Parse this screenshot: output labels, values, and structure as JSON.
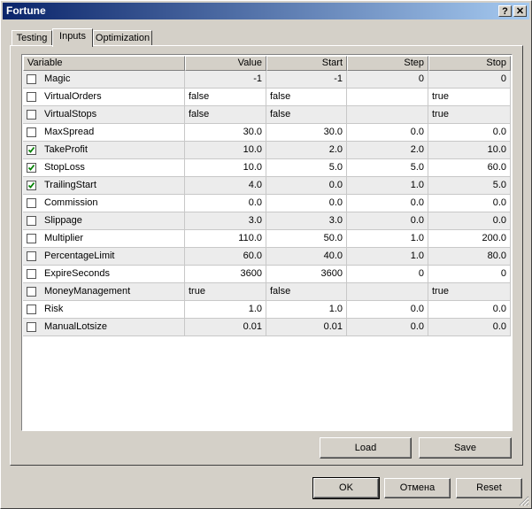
{
  "window": {
    "title": "Fortune",
    "help_glyph": "?",
    "close_glyph": "✕"
  },
  "tabs": [
    {
      "label": "Testing",
      "active": false
    },
    {
      "label": "Inputs",
      "active": true
    },
    {
      "label": "Optimization",
      "active": false
    }
  ],
  "table": {
    "headers": [
      "Variable",
      "Value",
      "Start",
      "Step",
      "Stop"
    ],
    "rows": [
      {
        "checked": false,
        "name": "Magic",
        "value": "-1",
        "start": "-1",
        "step": "0",
        "stop": "0"
      },
      {
        "checked": false,
        "name": "VirtualOrders",
        "value": "false",
        "start": "false",
        "step": "",
        "stop": "true"
      },
      {
        "checked": false,
        "name": "VirtualStops",
        "value": "false",
        "start": "false",
        "step": "",
        "stop": "true"
      },
      {
        "checked": false,
        "name": "MaxSpread",
        "value": "30.0",
        "start": "30.0",
        "step": "0.0",
        "stop": "0.0"
      },
      {
        "checked": true,
        "name": "TakeProfit",
        "value": "10.0",
        "start": "2.0",
        "step": "2.0",
        "stop": "10.0"
      },
      {
        "checked": true,
        "name": "StopLoss",
        "value": "10.0",
        "start": "5.0",
        "step": "5.0",
        "stop": "60.0"
      },
      {
        "checked": true,
        "name": "TrailingStart",
        "value": "4.0",
        "start": "0.0",
        "step": "1.0",
        "stop": "5.0"
      },
      {
        "checked": false,
        "name": "Commission",
        "value": "0.0",
        "start": "0.0",
        "step": "0.0",
        "stop": "0.0"
      },
      {
        "checked": false,
        "name": "Slippage",
        "value": "3.0",
        "start": "3.0",
        "step": "0.0",
        "stop": "0.0"
      },
      {
        "checked": false,
        "name": "Multiplier",
        "value": "110.0",
        "start": "50.0",
        "step": "1.0",
        "stop": "200.0"
      },
      {
        "checked": false,
        "name": "PercentageLimit",
        "value": "60.0",
        "start": "40.0",
        "step": "1.0",
        "stop": "80.0"
      },
      {
        "checked": false,
        "name": "ExpireSeconds",
        "value": "3600",
        "start": "3600",
        "step": "0",
        "stop": "0"
      },
      {
        "checked": false,
        "name": "MoneyManagement",
        "value": "true",
        "start": "false",
        "step": "",
        "stop": "true"
      },
      {
        "checked": false,
        "name": "Risk",
        "value": "1.0",
        "start": "1.0",
        "step": "0.0",
        "stop": "0.0"
      },
      {
        "checked": false,
        "name": "ManualLotsize",
        "value": "0.01",
        "start": "0.01",
        "step": "0.0",
        "stop": "0.0"
      }
    ]
  },
  "buttons": {
    "load": "Load",
    "save": "Save",
    "ok": "OK",
    "cancel": "Отмена",
    "reset": "Reset"
  },
  "colors": {
    "check": "#008000",
    "title_start": "#0a246a",
    "title_end": "#a6caf0"
  }
}
